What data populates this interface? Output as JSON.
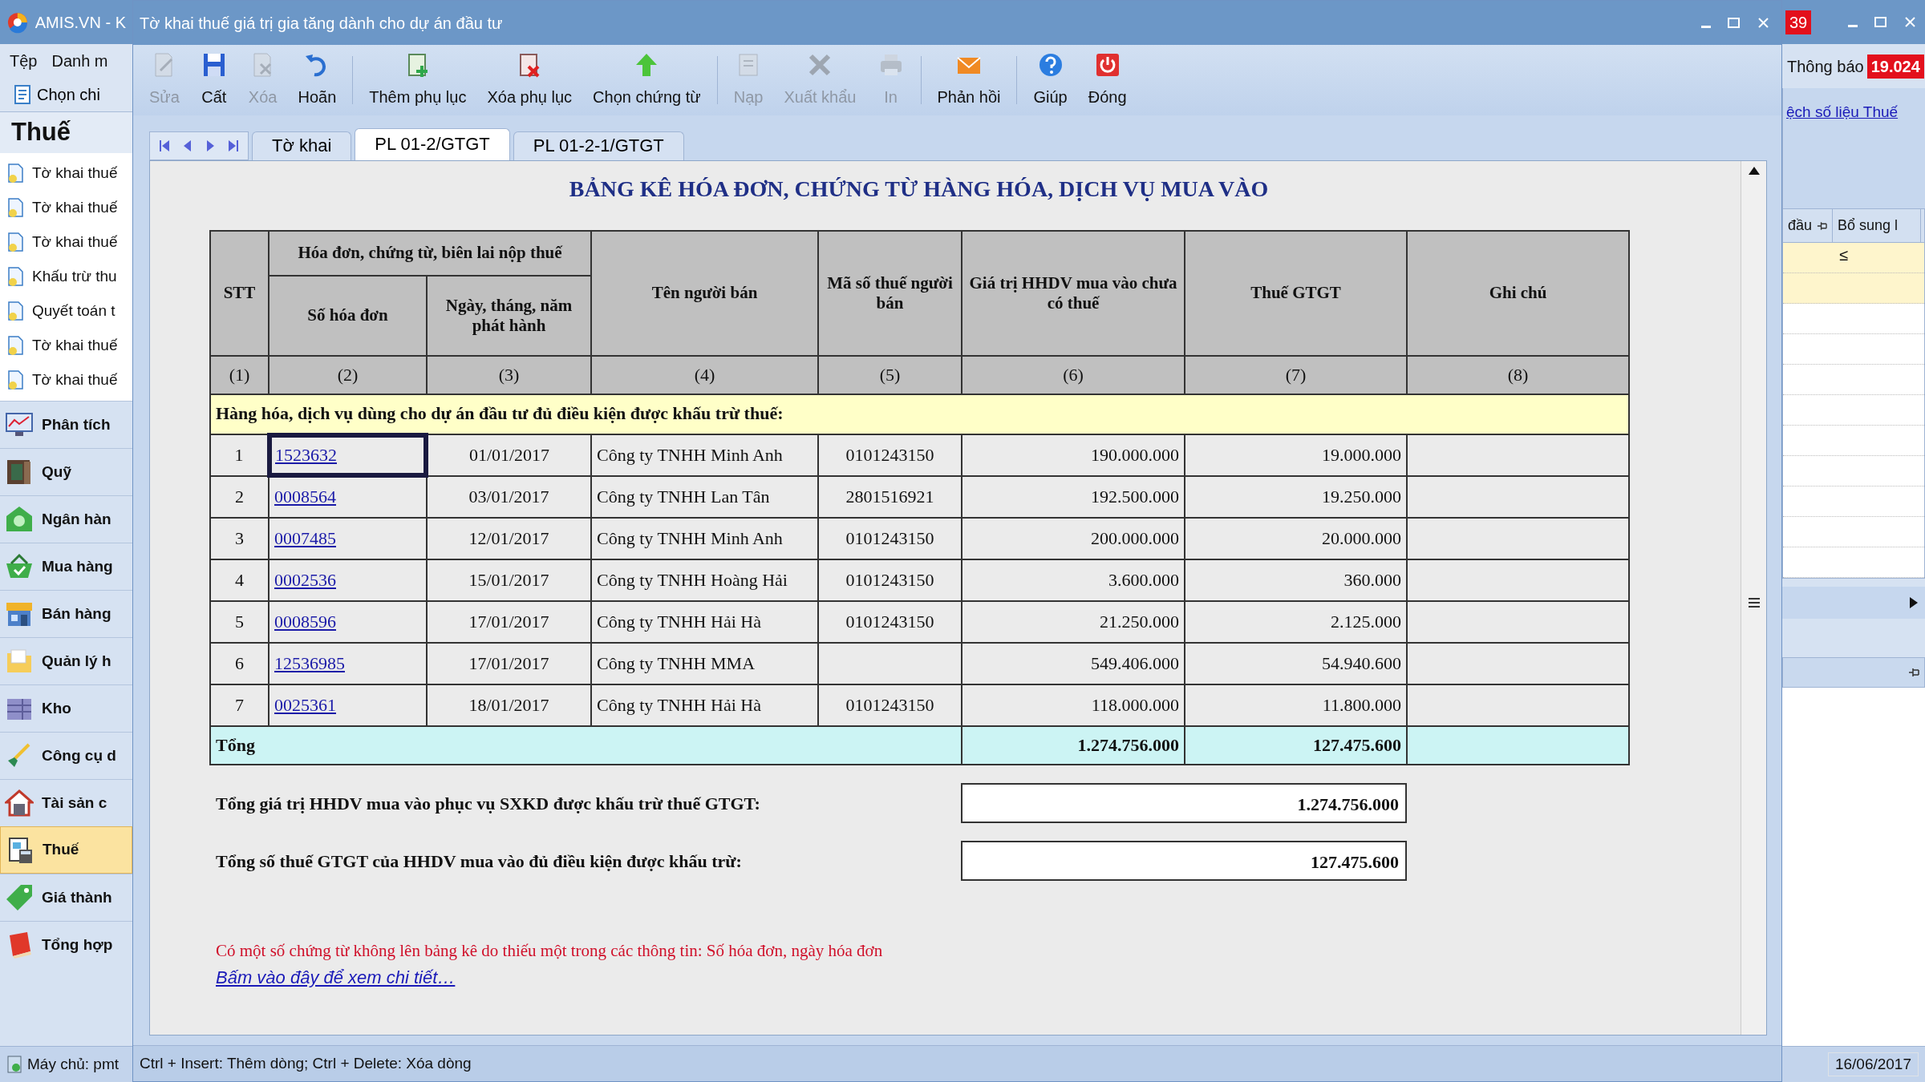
{
  "app": {
    "title": "AMIS.VN - K",
    "badge": "39",
    "menu": [
      "Tệp",
      "Danh m"
    ],
    "toolbar_item": "Chọn chi",
    "notice_label": "Thông báo",
    "notice_count": "19.024",
    "sidebar": {
      "title": "Thuế",
      "items": [
        "Tờ khai thuế",
        "Tờ khai thuế",
        "Tờ khai thuế",
        "Khấu trừ thu",
        "Quyết toán t",
        "Tờ khai thuế",
        "Tờ khai thuế"
      ],
      "modules": [
        {
          "label": "Phân tích",
          "kind": "chart",
          "selected": false
        },
        {
          "label": "Quỹ",
          "kind": "safe",
          "selected": false
        },
        {
          "label": "Ngân hàn",
          "kind": "bank",
          "selected": false
        },
        {
          "label": "Mua hàng",
          "kind": "basket",
          "selected": false
        },
        {
          "label": "Bán hàng",
          "kind": "shop",
          "selected": false
        },
        {
          "label": "Quản lý h",
          "kind": "folder",
          "selected": false
        },
        {
          "label": "Kho",
          "kind": "warehouse",
          "selected": false
        },
        {
          "label": "Công cụ d",
          "kind": "tool",
          "selected": false
        },
        {
          "label": "Tài sản c",
          "kind": "house",
          "selected": false
        },
        {
          "label": "Thuế",
          "kind": "tax",
          "selected": true
        },
        {
          "label": "Giá thành",
          "kind": "tag",
          "selected": false
        },
        {
          "label": "Tổng hợp",
          "kind": "book",
          "selected": false
        }
      ]
    },
    "right_panel": {
      "link": "ệch số liệu Thuế",
      "columns": [
        "đầu",
        "Bổ sung l"
      ],
      "cell": "≤"
    },
    "status": {
      "server": "Máy chủ: pmt",
      "date": "16/06/2017"
    }
  },
  "dialog": {
    "title": "Tờ khai thuế giá trị gia tăng dành cho dự án đầu tư",
    "toolbar": [
      {
        "label": "Sửa",
        "kind": "edit",
        "disabled": true
      },
      {
        "label": "Cất",
        "kind": "save",
        "disabled": false
      },
      {
        "label": "Xóa",
        "kind": "delete",
        "disabled": true
      },
      {
        "label": "Hoãn",
        "kind": "undo",
        "disabled": false
      },
      {
        "label": "Thêm phụ lục",
        "kind": "add-appendix",
        "disabled": false
      },
      {
        "label": "Xóa phụ lục",
        "kind": "delete-appendix",
        "disabled": false
      },
      {
        "label": "Chọn chứng từ",
        "kind": "choose",
        "disabled": false
      },
      {
        "label": "Nạp",
        "kind": "load",
        "disabled": true
      },
      {
        "label": "Xuất khẩu",
        "kind": "export",
        "disabled": true
      },
      {
        "label": "In",
        "kind": "print",
        "disabled": true
      },
      {
        "label": "Phản hồi",
        "kind": "feedback",
        "disabled": false
      },
      {
        "label": "Giúp",
        "kind": "help",
        "disabled": false
      },
      {
        "label": "Đóng",
        "kind": "close",
        "disabled": false
      }
    ],
    "tabs": [
      {
        "label": "Tờ khai",
        "selected": false
      },
      {
        "label": "PL 01-2/GTGT",
        "selected": true
      },
      {
        "label": "PL 01-2-1/GTGT",
        "selected": false
      }
    ],
    "report": {
      "title": "BẢNG KÊ HÓA ĐƠN, CHỨNG TỪ HÀNG HÓA, DỊCH VỤ MUA VÀO",
      "group_header": "Hóa đơn, chứng từ, biên lai nộp thuế",
      "columns": [
        "STT",
        "Số hóa đơn",
        "Ngày, tháng, năm phát hành",
        "Tên người bán",
        "Mã số thuế người bán",
        "Giá trị HHDV mua vào chưa có thuế",
        "Thuế GTGT",
        "Ghi chú"
      ],
      "column_numbers": [
        "(1)",
        "(2)",
        "(3)",
        "(4)",
        "(5)",
        "(6)",
        "(7)",
        "(8)"
      ],
      "section": "Hàng hóa, dịch vụ dùng cho dự án đầu tư đủ điều kiện được khấu trừ thuế:",
      "rows": [
        {
          "stt": "1",
          "invoice": "1523632",
          "date": "01/01/2017",
          "seller": "Công ty TNHH Minh Anh",
          "tax_code": "0101243150",
          "value": "190.000.000",
          "vat": "19.000.000",
          "selected": true
        },
        {
          "stt": "2",
          "invoice": "0008564",
          "date": "03/01/2017",
          "seller": "Công ty TNHH Lan Tân",
          "tax_code": "2801516921",
          "value": "192.500.000",
          "vat": "19.250.000",
          "selected": false
        },
        {
          "stt": "3",
          "invoice": "0007485",
          "date": "12/01/2017",
          "seller": "Công ty TNHH Minh Anh",
          "tax_code": "0101243150",
          "value": "200.000.000",
          "vat": "20.000.000",
          "selected": false
        },
        {
          "stt": "4",
          "invoice": "0002536",
          "date": "15/01/2017",
          "seller": "Công ty TNHH Hoàng Hải",
          "tax_code": "0101243150",
          "value": "3.600.000",
          "vat": "360.000",
          "selected": false
        },
        {
          "stt": "5",
          "invoice": "0008596",
          "date": "17/01/2017",
          "seller": "Công ty TNHH Hải Hà",
          "tax_code": "0101243150",
          "value": "21.250.000",
          "vat": "2.125.000",
          "selected": false
        },
        {
          "stt": "6",
          "invoice": "12536985",
          "date": "17/01/2017",
          "seller": "Công ty TNHH MMA",
          "value": "549.406.000",
          "vat": "54.940.600",
          "selected": false
        },
        {
          "stt": "7",
          "invoice": "0025361",
          "date": "18/01/2017",
          "seller": "Công ty TNHH Hải Hà",
          "tax_code": "0101243150",
          "value": "118.000.000",
          "vat": "11.800.000",
          "selected": false
        }
      ],
      "total": {
        "label": "Tổng",
        "value": "1.274.756.000",
        "vat": "127.475.600"
      },
      "summary": [
        {
          "label": "Tổng giá trị HHDV mua vào phục vụ SXKD được khấu trừ thuế GTGT:",
          "value": "1.274.756.000"
        },
        {
          "label": "Tổng số thuế GTGT của HHDV mua vào đủ điều kiện được khấu trừ:",
          "value": "127.475.600"
        }
      ],
      "note": "Có một số chứng từ không lên bảng kê do thiếu một trong các thông tin: Số hóa đơn, ngày hóa đơn",
      "link": "Bấm vào đây để xem chi tiết…"
    },
    "status": "Ctrl + Insert: Thêm dòng; Ctrl + Delete: Xóa dòng"
  }
}
